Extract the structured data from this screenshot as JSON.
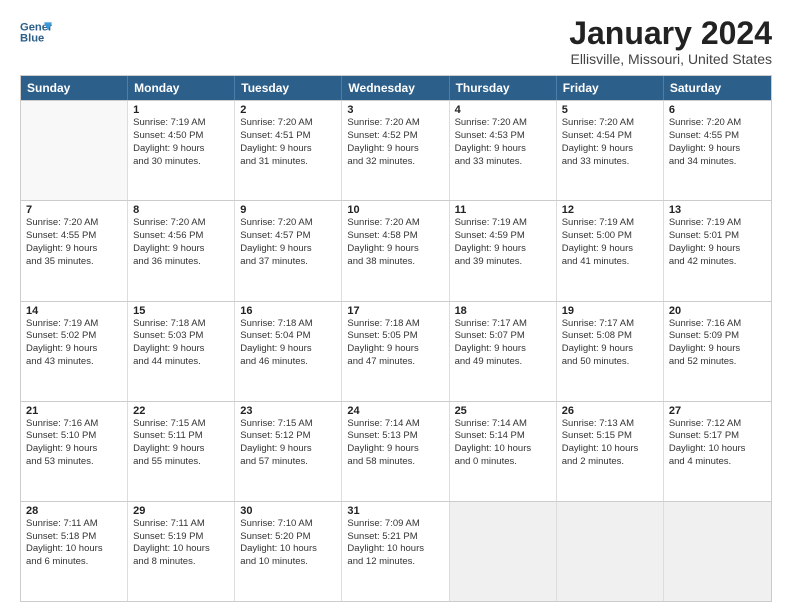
{
  "logo": {
    "line1": "General",
    "line2": "Blue"
  },
  "title": "January 2024",
  "subtitle": "Ellisville, Missouri, United States",
  "header_days": [
    "Sunday",
    "Monday",
    "Tuesday",
    "Wednesday",
    "Thursday",
    "Friday",
    "Saturday"
  ],
  "weeks": [
    [
      {
        "day": "",
        "info": "",
        "empty": true
      },
      {
        "day": "1",
        "info": "Sunrise: 7:19 AM\nSunset: 4:50 PM\nDaylight: 9 hours\nand 30 minutes."
      },
      {
        "day": "2",
        "info": "Sunrise: 7:20 AM\nSunset: 4:51 PM\nDaylight: 9 hours\nand 31 minutes."
      },
      {
        "day": "3",
        "info": "Sunrise: 7:20 AM\nSunset: 4:52 PM\nDaylight: 9 hours\nand 32 minutes."
      },
      {
        "day": "4",
        "info": "Sunrise: 7:20 AM\nSunset: 4:53 PM\nDaylight: 9 hours\nand 33 minutes."
      },
      {
        "day": "5",
        "info": "Sunrise: 7:20 AM\nSunset: 4:54 PM\nDaylight: 9 hours\nand 33 minutes."
      },
      {
        "day": "6",
        "info": "Sunrise: 7:20 AM\nSunset: 4:55 PM\nDaylight: 9 hours\nand 34 minutes."
      }
    ],
    [
      {
        "day": "7",
        "info": "Sunrise: 7:20 AM\nSunset: 4:55 PM\nDaylight: 9 hours\nand 35 minutes."
      },
      {
        "day": "8",
        "info": "Sunrise: 7:20 AM\nSunset: 4:56 PM\nDaylight: 9 hours\nand 36 minutes."
      },
      {
        "day": "9",
        "info": "Sunrise: 7:20 AM\nSunset: 4:57 PM\nDaylight: 9 hours\nand 37 minutes."
      },
      {
        "day": "10",
        "info": "Sunrise: 7:20 AM\nSunset: 4:58 PM\nDaylight: 9 hours\nand 38 minutes."
      },
      {
        "day": "11",
        "info": "Sunrise: 7:19 AM\nSunset: 4:59 PM\nDaylight: 9 hours\nand 39 minutes."
      },
      {
        "day": "12",
        "info": "Sunrise: 7:19 AM\nSunset: 5:00 PM\nDaylight: 9 hours\nand 41 minutes."
      },
      {
        "day": "13",
        "info": "Sunrise: 7:19 AM\nSunset: 5:01 PM\nDaylight: 9 hours\nand 42 minutes."
      }
    ],
    [
      {
        "day": "14",
        "info": "Sunrise: 7:19 AM\nSunset: 5:02 PM\nDaylight: 9 hours\nand 43 minutes."
      },
      {
        "day": "15",
        "info": "Sunrise: 7:18 AM\nSunset: 5:03 PM\nDaylight: 9 hours\nand 44 minutes."
      },
      {
        "day": "16",
        "info": "Sunrise: 7:18 AM\nSunset: 5:04 PM\nDaylight: 9 hours\nand 46 minutes."
      },
      {
        "day": "17",
        "info": "Sunrise: 7:18 AM\nSunset: 5:05 PM\nDaylight: 9 hours\nand 47 minutes."
      },
      {
        "day": "18",
        "info": "Sunrise: 7:17 AM\nSunset: 5:07 PM\nDaylight: 9 hours\nand 49 minutes."
      },
      {
        "day": "19",
        "info": "Sunrise: 7:17 AM\nSunset: 5:08 PM\nDaylight: 9 hours\nand 50 minutes."
      },
      {
        "day": "20",
        "info": "Sunrise: 7:16 AM\nSunset: 5:09 PM\nDaylight: 9 hours\nand 52 minutes."
      }
    ],
    [
      {
        "day": "21",
        "info": "Sunrise: 7:16 AM\nSunset: 5:10 PM\nDaylight: 9 hours\nand 53 minutes."
      },
      {
        "day": "22",
        "info": "Sunrise: 7:15 AM\nSunset: 5:11 PM\nDaylight: 9 hours\nand 55 minutes."
      },
      {
        "day": "23",
        "info": "Sunrise: 7:15 AM\nSunset: 5:12 PM\nDaylight: 9 hours\nand 57 minutes."
      },
      {
        "day": "24",
        "info": "Sunrise: 7:14 AM\nSunset: 5:13 PM\nDaylight: 9 hours\nand 58 minutes."
      },
      {
        "day": "25",
        "info": "Sunrise: 7:14 AM\nSunset: 5:14 PM\nDaylight: 10 hours\nand 0 minutes."
      },
      {
        "day": "26",
        "info": "Sunrise: 7:13 AM\nSunset: 5:15 PM\nDaylight: 10 hours\nand 2 minutes."
      },
      {
        "day": "27",
        "info": "Sunrise: 7:12 AM\nSunset: 5:17 PM\nDaylight: 10 hours\nand 4 minutes."
      }
    ],
    [
      {
        "day": "28",
        "info": "Sunrise: 7:11 AM\nSunset: 5:18 PM\nDaylight: 10 hours\nand 6 minutes."
      },
      {
        "day": "29",
        "info": "Sunrise: 7:11 AM\nSunset: 5:19 PM\nDaylight: 10 hours\nand 8 minutes."
      },
      {
        "day": "30",
        "info": "Sunrise: 7:10 AM\nSunset: 5:20 PM\nDaylight: 10 hours\nand 10 minutes."
      },
      {
        "day": "31",
        "info": "Sunrise: 7:09 AM\nSunset: 5:21 PM\nDaylight: 10 hours\nand 12 minutes."
      },
      {
        "day": "",
        "info": "",
        "empty": true,
        "shaded": true
      },
      {
        "day": "",
        "info": "",
        "empty": true,
        "shaded": true
      },
      {
        "day": "",
        "info": "",
        "empty": true,
        "shaded": true
      }
    ]
  ]
}
